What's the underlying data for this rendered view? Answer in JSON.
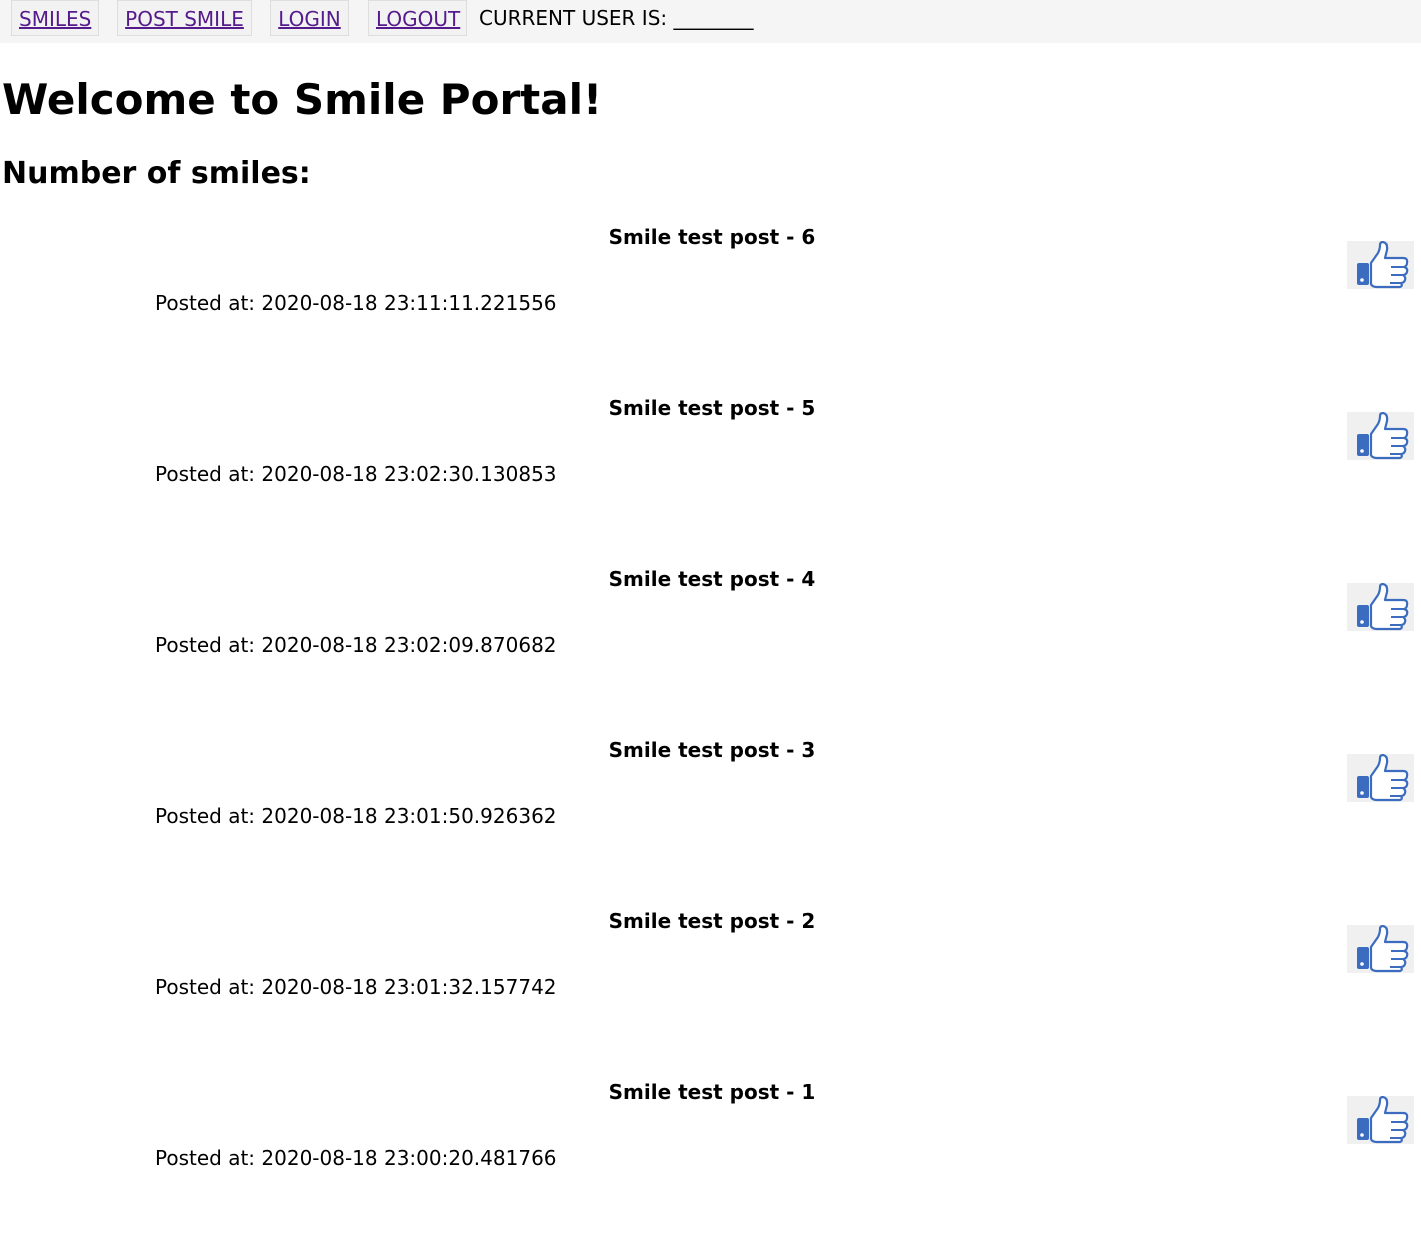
{
  "nav": {
    "smiles_label": "SMILES",
    "post_smile_label": "POST SMILE",
    "login_label": "LOGIN",
    "logout_label": "LOGOUT",
    "current_user_text": "CURRENT USER IS: ________"
  },
  "main": {
    "title": "Welcome to Smile Portal!",
    "subtitle": "Number of smiles:"
  },
  "posts": [
    {
      "title": "Smile test post - 6",
      "posted": "Posted at: 2020-08-18 23:11:11.221556",
      "like_icon": "thumbs-up-icon"
    },
    {
      "title": "Smile test post - 5",
      "posted": "Posted at: 2020-08-18 23:02:30.130853",
      "like_icon": "thumbs-up-icon"
    },
    {
      "title": "Smile test post - 4",
      "posted": "Posted at: 2020-08-18 23:02:09.870682",
      "like_icon": "thumbs-up-icon"
    },
    {
      "title": "Smile test post - 3",
      "posted": "Posted at: 2020-08-18 23:01:50.926362",
      "like_icon": "thumbs-up-icon"
    },
    {
      "title": "Smile test post - 2",
      "posted": "Posted at: 2020-08-18 23:01:32.157742",
      "like_icon": "thumbs-up-icon"
    },
    {
      "title": "Smile test post - 1",
      "posted": "Posted at: 2020-08-18 23:00:20.481766",
      "like_icon": "thumbs-up-icon"
    }
  ],
  "colors": {
    "link": "#551a8b",
    "thumb_blue": "#3b6cc0",
    "topbar_bg": "#f5f5f5"
  }
}
